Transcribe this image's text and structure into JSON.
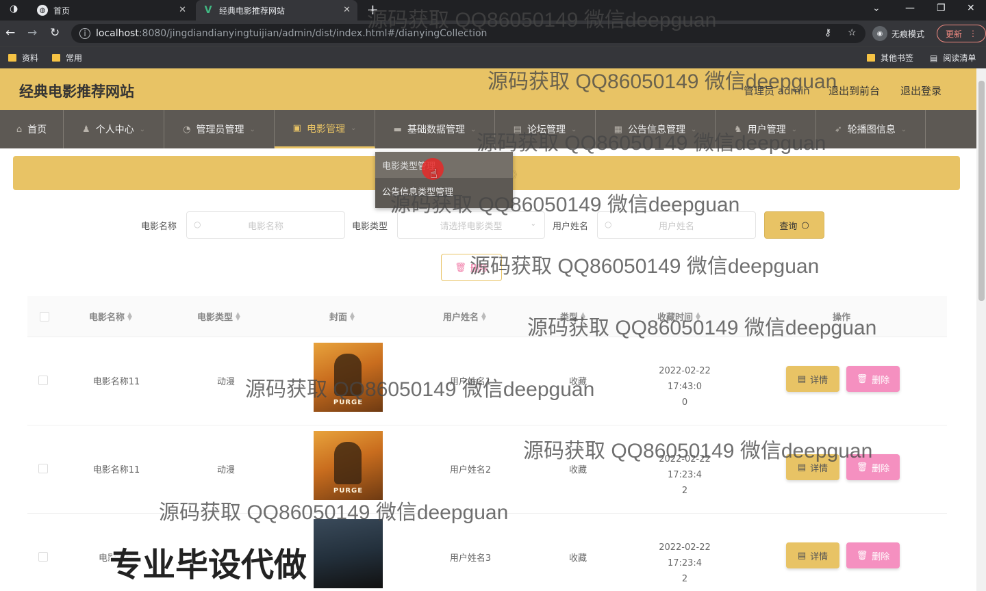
{
  "browser": {
    "tabs": [
      {
        "title": "首页"
      },
      {
        "title": "经典电影推荐网站"
      }
    ],
    "url_host": "localhost",
    "url_rest": ":8080/jingdiandianyingtuijian/admin/dist/index.html#/dianyingCollection",
    "incognito_label": "无痕模式",
    "update_label": "更新",
    "bookmarks": [
      "资料",
      "常用"
    ],
    "bookmarks_right": [
      "其他书签",
      "阅读清单"
    ]
  },
  "header": {
    "site_title": "经典电影推荐网站",
    "user_label": "管理员 admin",
    "to_front": "退出到前台",
    "logout": "退出登录"
  },
  "menu": [
    {
      "label": "首页",
      "icon": "home-icon"
    },
    {
      "label": "个人中心",
      "icon": "user-icon"
    },
    {
      "label": "管理员管理",
      "icon": "admin-icon"
    },
    {
      "label": "电影管理",
      "icon": "film-icon",
      "active": true
    },
    {
      "label": "基础数据管理",
      "icon": "briefcase-icon"
    },
    {
      "label": "论坛管理",
      "icon": "forum-icon"
    },
    {
      "label": "公告信息管理",
      "icon": "notice-icon"
    },
    {
      "label": "用户管理",
      "icon": "users-icon"
    },
    {
      "label": "轮播图信息",
      "icon": "send-icon"
    }
  ],
  "dropdown": [
    "电影类型管理",
    "公告信息类型管理"
  ],
  "search": {
    "name_label": "电影名称",
    "name_placeholder": "电影名称",
    "type_label": "电影类型",
    "type_placeholder": "请选择电影类型",
    "user_label": "用户姓名",
    "user_placeholder": "用户姓名",
    "query_label": "查询"
  },
  "batch_delete_label": "删除",
  "table": {
    "columns": [
      "电影名称",
      "电影类型",
      "封面",
      "用户姓名",
      "类型",
      "收藏时间",
      "操作"
    ],
    "rows": [
      {
        "name": "电影名称11",
        "type": "动漫",
        "poster_text": "PURGE",
        "user": "用户姓名1",
        "kind": "收藏",
        "time_1": "2022-02-22 17:43:0",
        "time_2": "0"
      },
      {
        "name": "电影名称11",
        "type": "动漫",
        "poster_text": "PURGE",
        "user": "用户姓名2",
        "kind": "收藏",
        "time_1": "2022-02-22 17:23:4",
        "time_2": "2"
      },
      {
        "name": "电影名称",
        "type": "",
        "poster_text": "",
        "user": "用户姓名3",
        "kind": "收藏",
        "time_1": "2022-02-22 17:23:4",
        "time_2": "2"
      }
    ],
    "detail_label": "详情",
    "delete_label": "删除"
  },
  "watermark": {
    "text": "源码获取 QQ86050149 微信deepguan",
    "big_text": "专业毕设代做"
  },
  "colors": {
    "accent": "#e8c365",
    "menu_bg": "#5d5954",
    "danger": "#f590c0"
  }
}
